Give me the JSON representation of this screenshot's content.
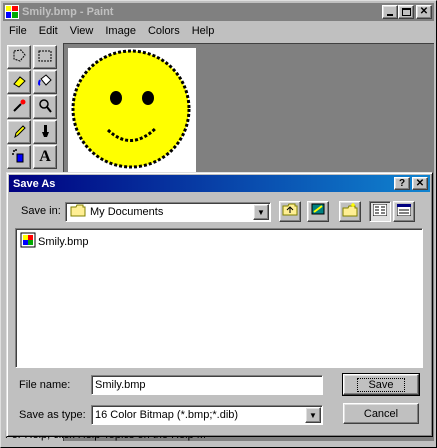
{
  "paint": {
    "title": "Smily.bmp - Paint",
    "menu": [
      "File",
      "Edit",
      "View",
      "Image",
      "Colors",
      "Help"
    ],
    "status_text": "For Help, click Help Topics on the Help Menu."
  },
  "dialog": {
    "title": "Save As",
    "save_in_label": "Save in:",
    "save_in_value": "My Documents",
    "files": [
      {
        "name": "Smily.bmp"
      }
    ],
    "file_name_label": "File name:",
    "file_name_value": "Smily.bmp",
    "save_as_type_label": "Save as type:",
    "save_as_type_value": "16 Color Bitmap (*.bmp;*.dib)",
    "save_button": "Save",
    "cancel_button": "Cancel"
  },
  "colors": {
    "titlebar_active": "#000080",
    "titlebar_inactive": "#808080",
    "face": "#c0c0c0",
    "smiley_fill": "#ffff00"
  }
}
